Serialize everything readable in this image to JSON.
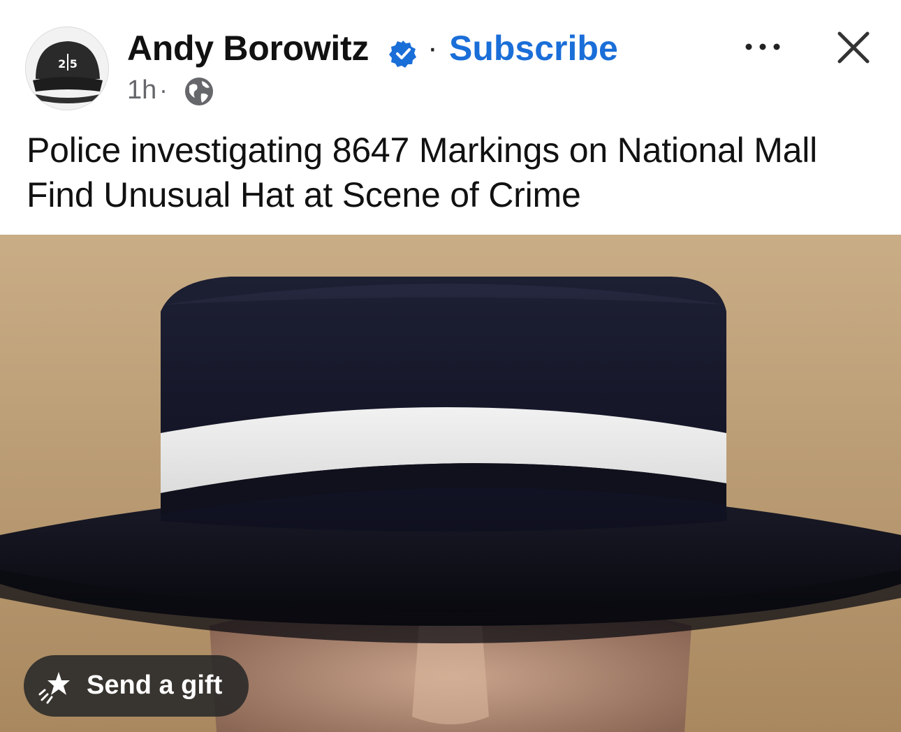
{
  "post": {
    "author": {
      "name": "Andy Borowitz",
      "verified_icon": "verified-badge-icon",
      "avatar_text": "2 5"
    },
    "header": {
      "separator": "·",
      "subscribe_label": "Subscribe",
      "more_icon": "more-options-icon",
      "close_icon": "close-icon"
    },
    "meta": {
      "time": "1h",
      "separator": "·",
      "audience_icon": "globe-icon"
    },
    "text": "Police investigating 8647 Markings on National Mall Find Unusual Hat at Scene of Crime",
    "photo": {
      "subject": "photo"
    },
    "gift": {
      "label": "Send a gift",
      "icon": "gift-sparkle-icon"
    }
  },
  "colors": {
    "accent": "#1a6ed8",
    "text": "#111111",
    "meta": "#65676b",
    "pill_bg": "#282828"
  }
}
